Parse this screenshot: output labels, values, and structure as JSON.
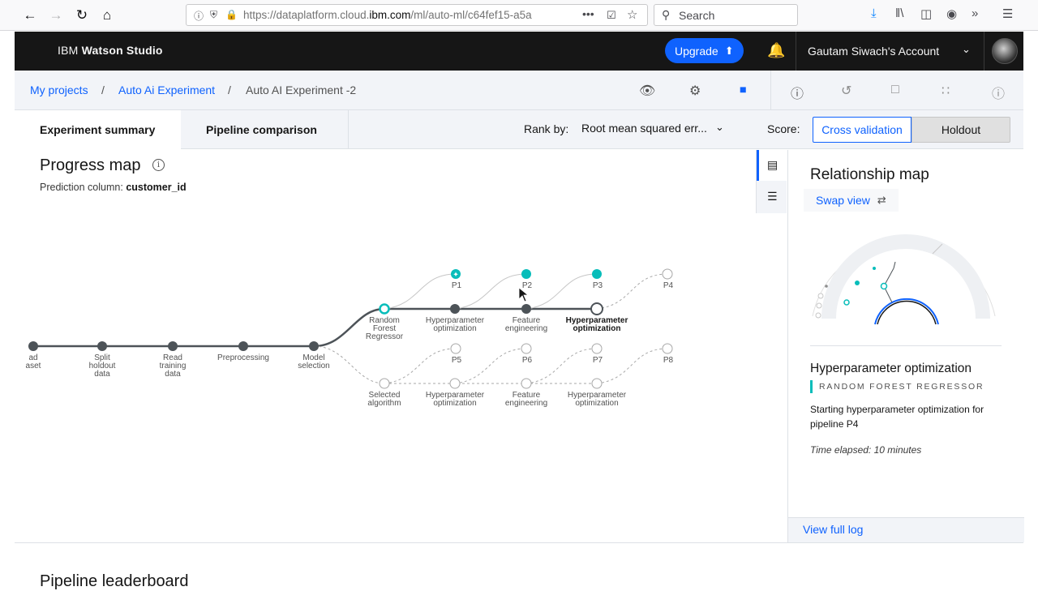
{
  "browser": {
    "url_domain_prefix": "https://dataplatform.cloud.",
    "url_domain": "ibm.com",
    "url_path": "/ml/auto-ml/c64fef15-a5a",
    "search_placeholder": "Search",
    "icons": [
      "back-icon",
      "forward-icon",
      "reload-icon",
      "home-icon",
      "info-icon",
      "shield-icon",
      "lock-icon",
      "more-icon",
      "pocket-icon",
      "bookmark-star-icon",
      "search-icon",
      "download-icon",
      "library-icon",
      "sidebar-icon",
      "account-icon",
      "overflow-icon",
      "menu-icon"
    ]
  },
  "appbar": {
    "brand_prefix": "IBM",
    "brand_name": "Watson Studio",
    "upgrade_label": "Upgrade",
    "account_label": "Gautam Siwach's Account",
    "colors": {
      "bar": "#161616",
      "upgrade": "#0f62fe"
    }
  },
  "breadcrumb": {
    "items": [
      "My projects",
      "Auto Ai Experiment",
      "Auto AI Experiment -2"
    ],
    "separator": "/"
  },
  "tabs": {
    "items": [
      "Experiment summary",
      "Pipeline comparison"
    ],
    "active": "Experiment summary",
    "rank_label": "Rank by:",
    "rank_value": "Root mean squared err...",
    "score_label": "Score:",
    "score_options": [
      "Cross validation",
      "Holdout"
    ],
    "score_selected": "Cross validation"
  },
  "progress_map": {
    "title": "Progress map",
    "prediction_label": "Prediction column:",
    "prediction_value": "customer_id",
    "main_nodes": [
      {
        "lines": [
          "ad",
          "aset"
        ]
      },
      {
        "lines": [
          "Split",
          "holdout",
          "data"
        ]
      },
      {
        "lines": [
          "Read",
          "training",
          "data"
        ]
      },
      {
        "lines": [
          "Preprocessing"
        ]
      },
      {
        "lines": [
          "Model",
          "selection"
        ]
      }
    ],
    "upper_branch": [
      {
        "lines": [
          "Random",
          "Forest",
          "Regressor"
        ],
        "state": "selected"
      },
      {
        "lines": [
          "Hyperparameter",
          "optimization"
        ],
        "state": "done"
      },
      {
        "lines": [
          "Feature",
          "engineering"
        ],
        "state": "done"
      },
      {
        "lines": [
          "Hyperparameter",
          "optimization"
        ],
        "state": "running"
      }
    ],
    "lower_branch": [
      {
        "lines": [
          "Selected",
          "algorithm"
        ]
      },
      {
        "lines": [
          "Hyperparameter",
          "optimization"
        ]
      },
      {
        "lines": [
          "Feature",
          "engineering"
        ]
      },
      {
        "lines": [
          "Hyperparameter",
          "optimization"
        ]
      }
    ],
    "pipelines_upper": [
      {
        "label": "P1",
        "state": "best"
      },
      {
        "label": "P2",
        "state": "done"
      },
      {
        "label": "P3",
        "state": "done"
      },
      {
        "label": "P4",
        "state": "pending"
      }
    ],
    "pipelines_lower": [
      {
        "label": "P5",
        "state": "pending"
      },
      {
        "label": "P6",
        "state": "pending"
      },
      {
        "label": "P7",
        "state": "pending"
      },
      {
        "label": "P8",
        "state": "pending"
      }
    ],
    "colors": {
      "done": "#4d5358",
      "pipeline": "#08bdba",
      "pending": "#a8a8a8"
    }
  },
  "relationship_map": {
    "title": "Relationship map",
    "swap_label": "Swap view",
    "status_title": "Hyperparameter optimization",
    "status_tag": "RANDOM FOREST REGRESSOR",
    "status_desc": "Starting hyperparameter optimization for pipeline P4",
    "status_time": "Time elapsed: 10 minutes",
    "footer_link": "View full log"
  },
  "leaderboard": {
    "title": "Pipeline leaderboard"
  }
}
